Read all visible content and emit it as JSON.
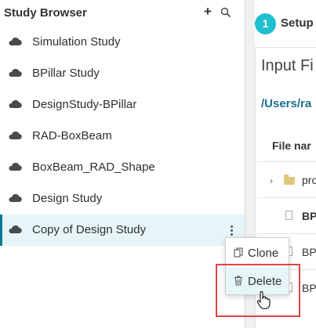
{
  "sidebar": {
    "title": "Study Browser",
    "add_icon": "plus-icon",
    "search_icon": "search-icon",
    "items": [
      {
        "label": "Simulation Study",
        "icon": "cloud-icon",
        "selected": false
      },
      {
        "label": "BPillar Study",
        "icon": "cloud-icon",
        "selected": false
      },
      {
        "label": "DesignStudy-BPillar",
        "icon": "cloud-icon",
        "selected": false
      },
      {
        "label": "RAD-BoxBeam",
        "icon": "cloud-icon",
        "selected": false
      },
      {
        "label": "BoxBeam_RAD_Shape",
        "icon": "cloud-icon",
        "selected": false
      },
      {
        "label": "Design Study",
        "icon": "cloud-icon",
        "selected": false
      },
      {
        "label": "Copy of Design Study",
        "icon": "cloud-icon",
        "selected": true
      }
    ]
  },
  "context_menu": {
    "items": [
      {
        "label": "Clone",
        "icon": "clone-icon"
      },
      {
        "label": "Delete",
        "icon": "trash-icon"
      }
    ]
  },
  "main": {
    "step_number": "1",
    "step_label": "Setup",
    "input_title": "Input Fi",
    "path": "/Users/ra",
    "column_header": "File nar",
    "files": [
      {
        "name": "pro",
        "type": "folder",
        "bold": false
      },
      {
        "name": "BP",
        "type": "file",
        "bold": true
      },
      {
        "name": "BP",
        "type": "file",
        "bold": false
      },
      {
        "name": "BP",
        "type": "file",
        "bold": false
      }
    ]
  },
  "colors": {
    "accent": "#20bfcf",
    "selected_bg": "#e6f6f8",
    "selected_bar": "#0a7a91",
    "path_link": "#1c6f8c",
    "highlight": "#e04343"
  }
}
